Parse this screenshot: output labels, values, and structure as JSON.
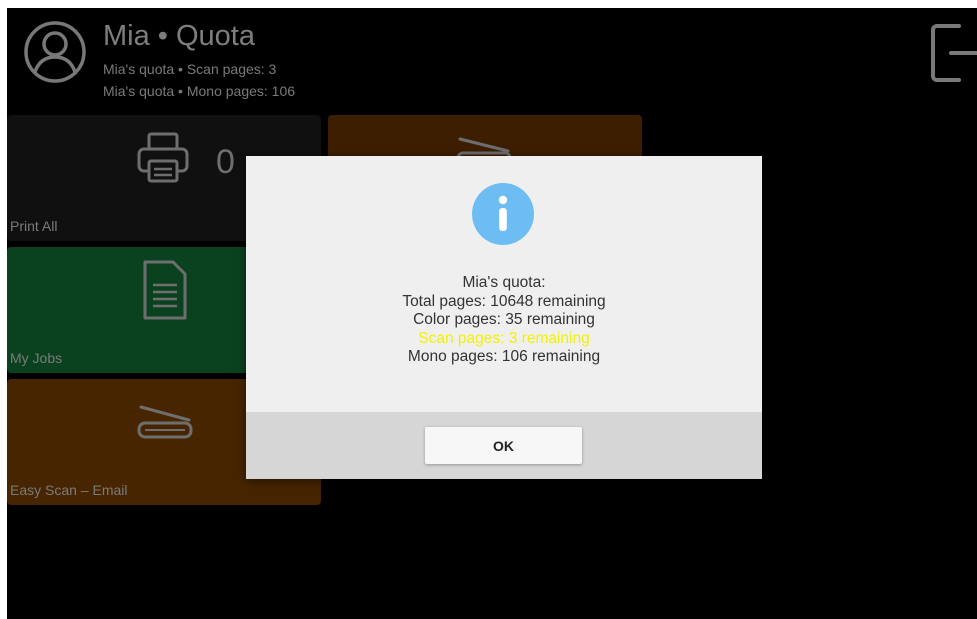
{
  "header": {
    "title": "Mia • Quota",
    "line1": "Mia's quota • Scan pages: 3",
    "line2": "Mia's quota • Mono pages: 106"
  },
  "tiles": {
    "print": {
      "label": "Print All",
      "count": "0"
    },
    "jobs": {
      "label": "My Jobs"
    },
    "easy_scan": {
      "label": "Easy Scan – Email"
    }
  },
  "dialog": {
    "heading": "Mia's quota:",
    "lines": [
      "Total pages: 10648 remaining",
      "Color pages: 35 remaining",
      "Scan pages: 3 remaining",
      "Mono pages: 106 remaining"
    ],
    "highlight_color": "#f2f200",
    "ok_label": "OK"
  },
  "colors": {
    "background": "#000000",
    "print_tile": "#1d1d1d",
    "jobs_tile": "#127238",
    "scan_tile": "#7a4002",
    "info_icon": "#6dbdf2"
  },
  "icons": [
    "user-avatar-icon",
    "logout-icon",
    "printer-icon",
    "document-icon",
    "scanner-icon",
    "info-icon"
  ]
}
